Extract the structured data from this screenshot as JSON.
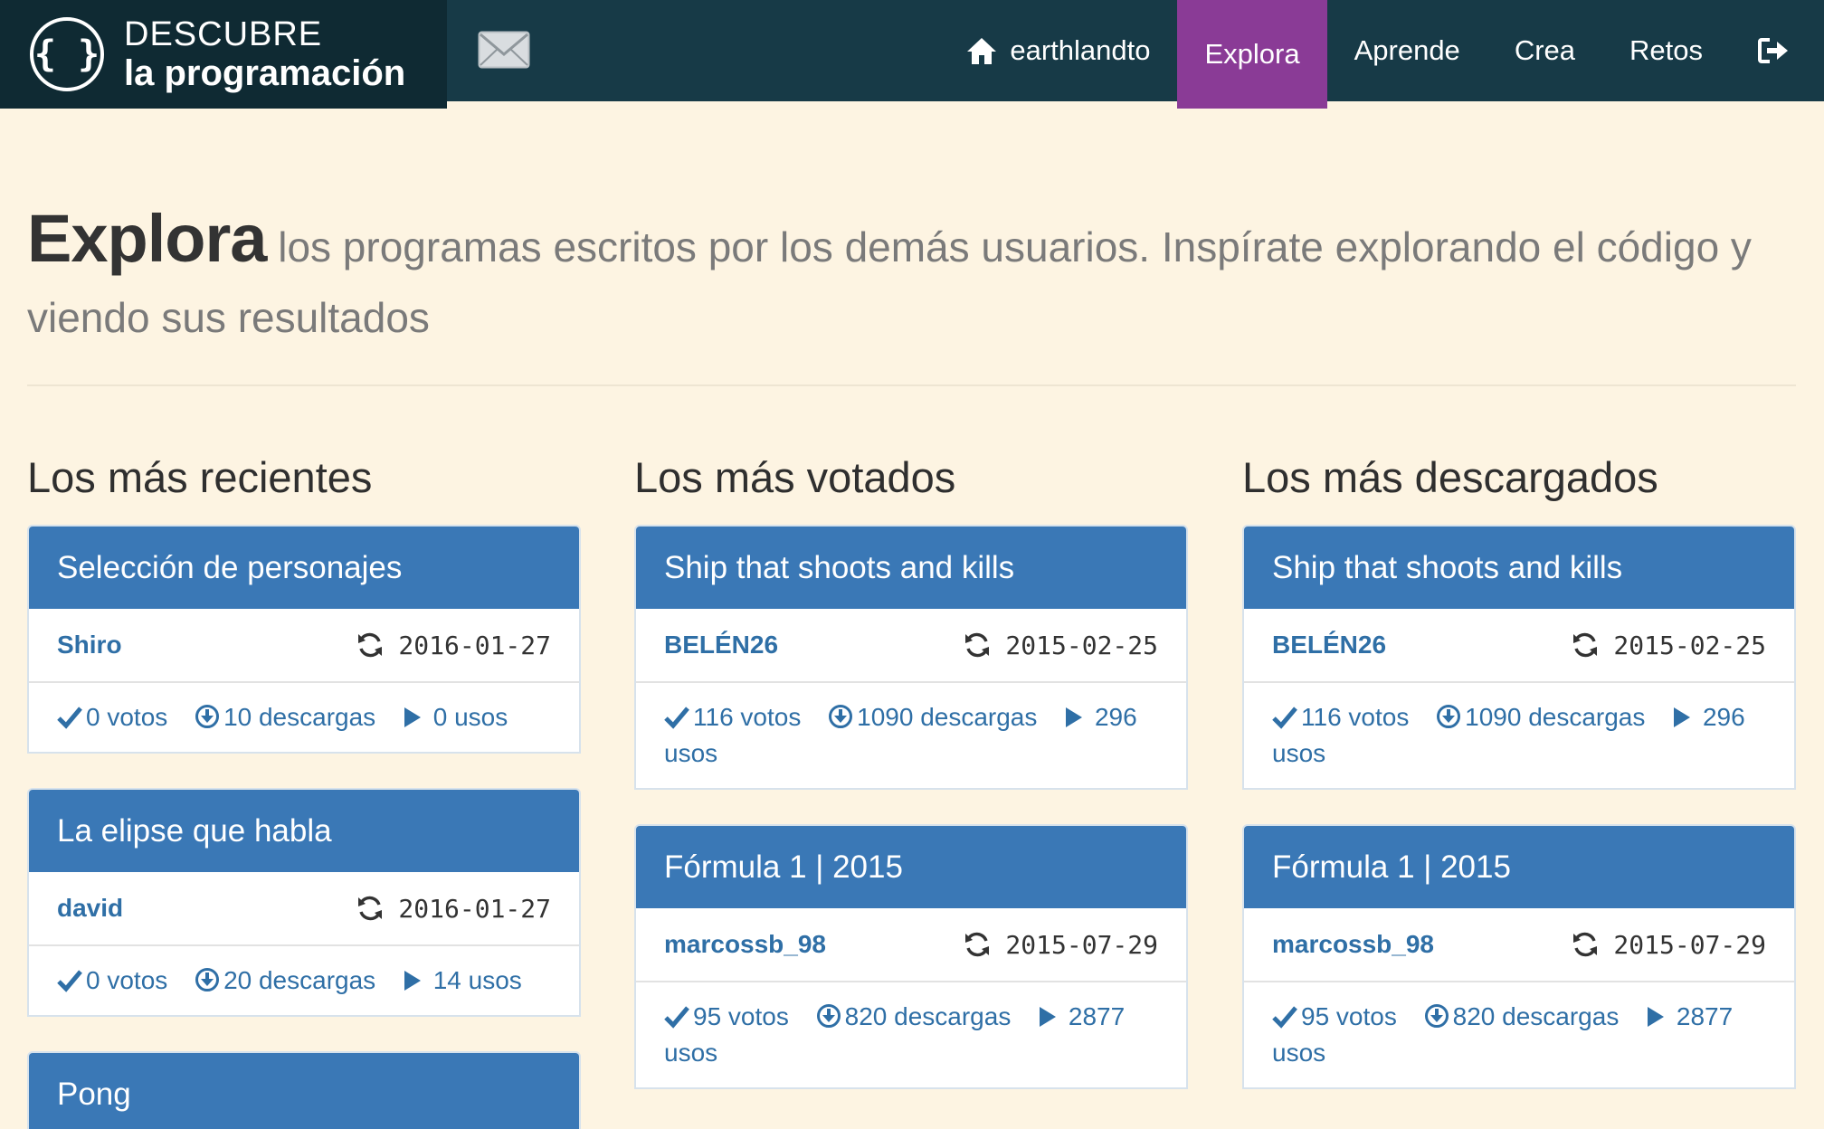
{
  "brand": {
    "line1": "DESCUBRE",
    "line2": "la programación",
    "logo_text": "{ }"
  },
  "nav": {
    "user": "earthlandto",
    "items": [
      {
        "label": "Explora",
        "active": true
      },
      {
        "label": "Aprende",
        "active": false
      },
      {
        "label": "Crea",
        "active": false
      },
      {
        "label": "Retos",
        "active": false
      }
    ]
  },
  "header": {
    "title": "Explora",
    "subtitle": "los programas escritos por los demás usuarios. Inspírate explorando el código y viendo sus resultados"
  },
  "colors": {
    "navbar": "#173a47",
    "brand_bg": "#0f2a33",
    "active": "#8a3b96",
    "card_header": "#3a78b6",
    "link": "#2f6fa6",
    "page_bg": "#fdf4e2"
  },
  "columns": [
    {
      "heading": "Los más recientes",
      "cards": [
        {
          "title": "Selección de personajes",
          "author": "Shiro",
          "date": "2016-01-27",
          "votes": "0 votos",
          "downloads": "10 descargas",
          "uses": "0 usos"
        },
        {
          "title": "La elipse que habla",
          "author": "david",
          "date": "2016-01-27",
          "votes": "0 votos",
          "downloads": "20 descargas",
          "uses": "14 usos"
        },
        {
          "title": "Pong"
        }
      ]
    },
    {
      "heading": "Los más votados",
      "cards": [
        {
          "title": "Ship that shoots and kills",
          "author": "BELÉN26",
          "date": "2015-02-25",
          "votes": "116 votos",
          "downloads": "1090 descargas",
          "uses": "296 usos"
        },
        {
          "title": "Fórmula 1 | 2015",
          "author": "marcossb_98",
          "date": "2015-07-29",
          "votes": "95 votos",
          "downloads": "820 descargas",
          "uses": "2877 usos"
        }
      ]
    },
    {
      "heading": "Los más descargados",
      "cards": [
        {
          "title": "Ship that shoots and kills",
          "author": "BELÉN26",
          "date": "2015-02-25",
          "votes": "116 votos",
          "downloads": "1090 descargas",
          "uses": "296 usos"
        },
        {
          "title": "Fórmula 1 | 2015",
          "author": "marcossb_98",
          "date": "2015-07-29",
          "votes": "95 votos",
          "downloads": "820 descargas",
          "uses": "2877 usos"
        }
      ]
    }
  ]
}
